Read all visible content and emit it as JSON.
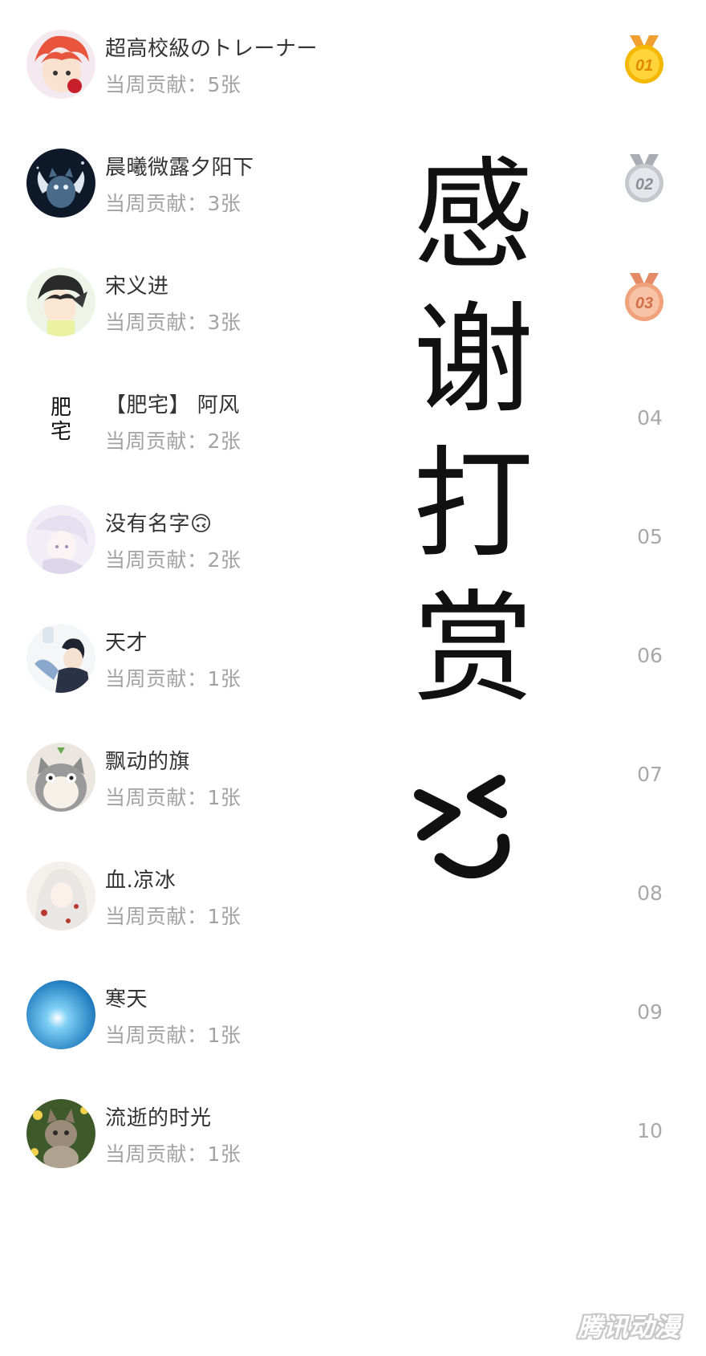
{
  "list": {
    "rows": [
      {
        "rank": "01",
        "name": "超高校級のトレーナー",
        "contribution": "当周贡献：5张",
        "medal": "gold"
      },
      {
        "rank": "02",
        "name": "晨曦微露夕阳下",
        "contribution": "当周贡献：3张",
        "medal": "silver"
      },
      {
        "rank": "03",
        "name": "宋义进",
        "contribution": "当周贡献：3张",
        "medal": "bronze"
      },
      {
        "rank": "04",
        "name": "【肥宅】 阿风",
        "contribution": "当周贡献：2张",
        "avatar_text": "肥宅"
      },
      {
        "rank": "05",
        "name": "没有名字🙃",
        "contribution": "当周贡献：2张"
      },
      {
        "rank": "06",
        "name": "天才",
        "contribution": "当周贡献：1张"
      },
      {
        "rank": "07",
        "name": "飘动的旗",
        "contribution": "当周贡献：1张"
      },
      {
        "rank": "08",
        "name": "血.凉冰",
        "contribution": "当周贡献：1张"
      },
      {
        "rank": "09",
        "name": "寒天",
        "contribution": "当周贡献：1张"
      },
      {
        "rank": "10",
        "name": "流逝的时光",
        "contribution": "当周贡献：1张"
      }
    ]
  },
  "overlay": {
    "text": "感谢打赏",
    "emoticon": "> <‿",
    "color": "#111111"
  },
  "watermark": {
    "text": "腾讯动漫"
  },
  "colors": {
    "name": "#333333",
    "contribution": "#a3a3a3",
    "rank": "#a8a8a8",
    "gold": "#f5b800",
    "silver": "#b8bcc2",
    "bronze": "#f0a27c"
  }
}
